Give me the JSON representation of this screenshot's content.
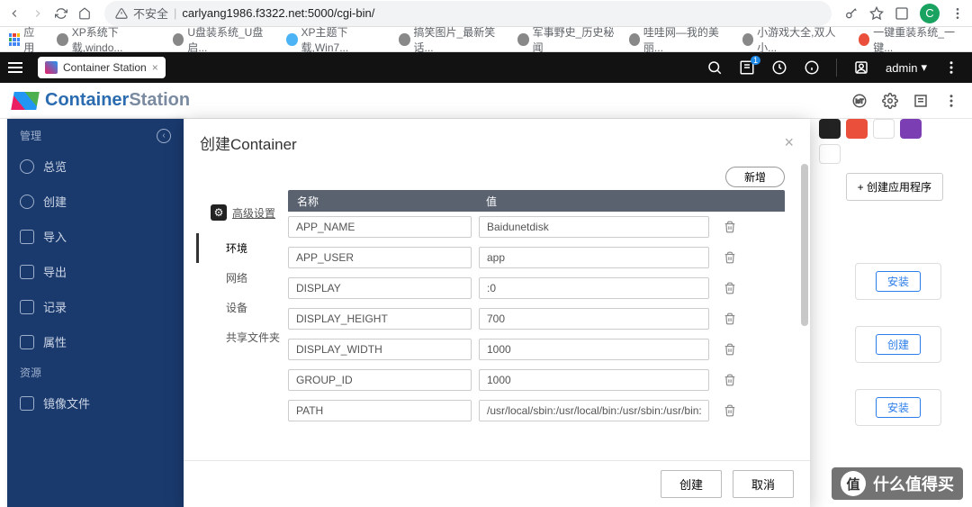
{
  "browser": {
    "security": "不安全",
    "url": "carlyang1986.f3322.net:5000/cgi-bin/",
    "avatar": "C"
  },
  "bookmarks": {
    "apps": "应用",
    "items": [
      "XP系统下载,windo...",
      "U盘装系统_U盘启...",
      "XP主题下载,Win7...",
      "搞笑图片_最新笑话...",
      "军事野史_历史秘闻",
      "哇哇网—我的美丽...",
      "小游戏大全,双人小...",
      "一键重装系统_一键..."
    ]
  },
  "qnap": {
    "tab": "Container Station",
    "badge": "1",
    "user": "admin"
  },
  "app": {
    "title1": "Container",
    "title2": "Station"
  },
  "sidebar": {
    "section1": "管理",
    "items": [
      "总览",
      "创建",
      "导入",
      "导出",
      "记录",
      "属性"
    ],
    "section2": "资源",
    "items2": [
      "镜像文件"
    ]
  },
  "bg": {
    "create_app": "+ 创建应用程序",
    "card_install": "安装",
    "card_create": "创建"
  },
  "modal": {
    "title": "创建Container",
    "advanced": "高级设置",
    "tabs": [
      "环境",
      "网络",
      "设备",
      "共享文件夹"
    ],
    "add": "新增",
    "col_name": "名称",
    "col_value": "值",
    "rows": [
      {
        "name": "APP_NAME",
        "value": "Baidunetdisk"
      },
      {
        "name": "APP_USER",
        "value": "app"
      },
      {
        "name": "DISPLAY",
        "value": ":0"
      },
      {
        "name": "DISPLAY_HEIGHT",
        "value": "700"
      },
      {
        "name": "DISPLAY_WIDTH",
        "value": "1000"
      },
      {
        "name": "GROUP_ID",
        "value": "1000"
      },
      {
        "name": "PATH",
        "value": "/usr/local/sbin:/usr/local/bin:/usr/sbin:/usr/bin:/sbin:/bi"
      }
    ],
    "create": "创建",
    "cancel": "取消"
  },
  "watermark": "什么值得买"
}
